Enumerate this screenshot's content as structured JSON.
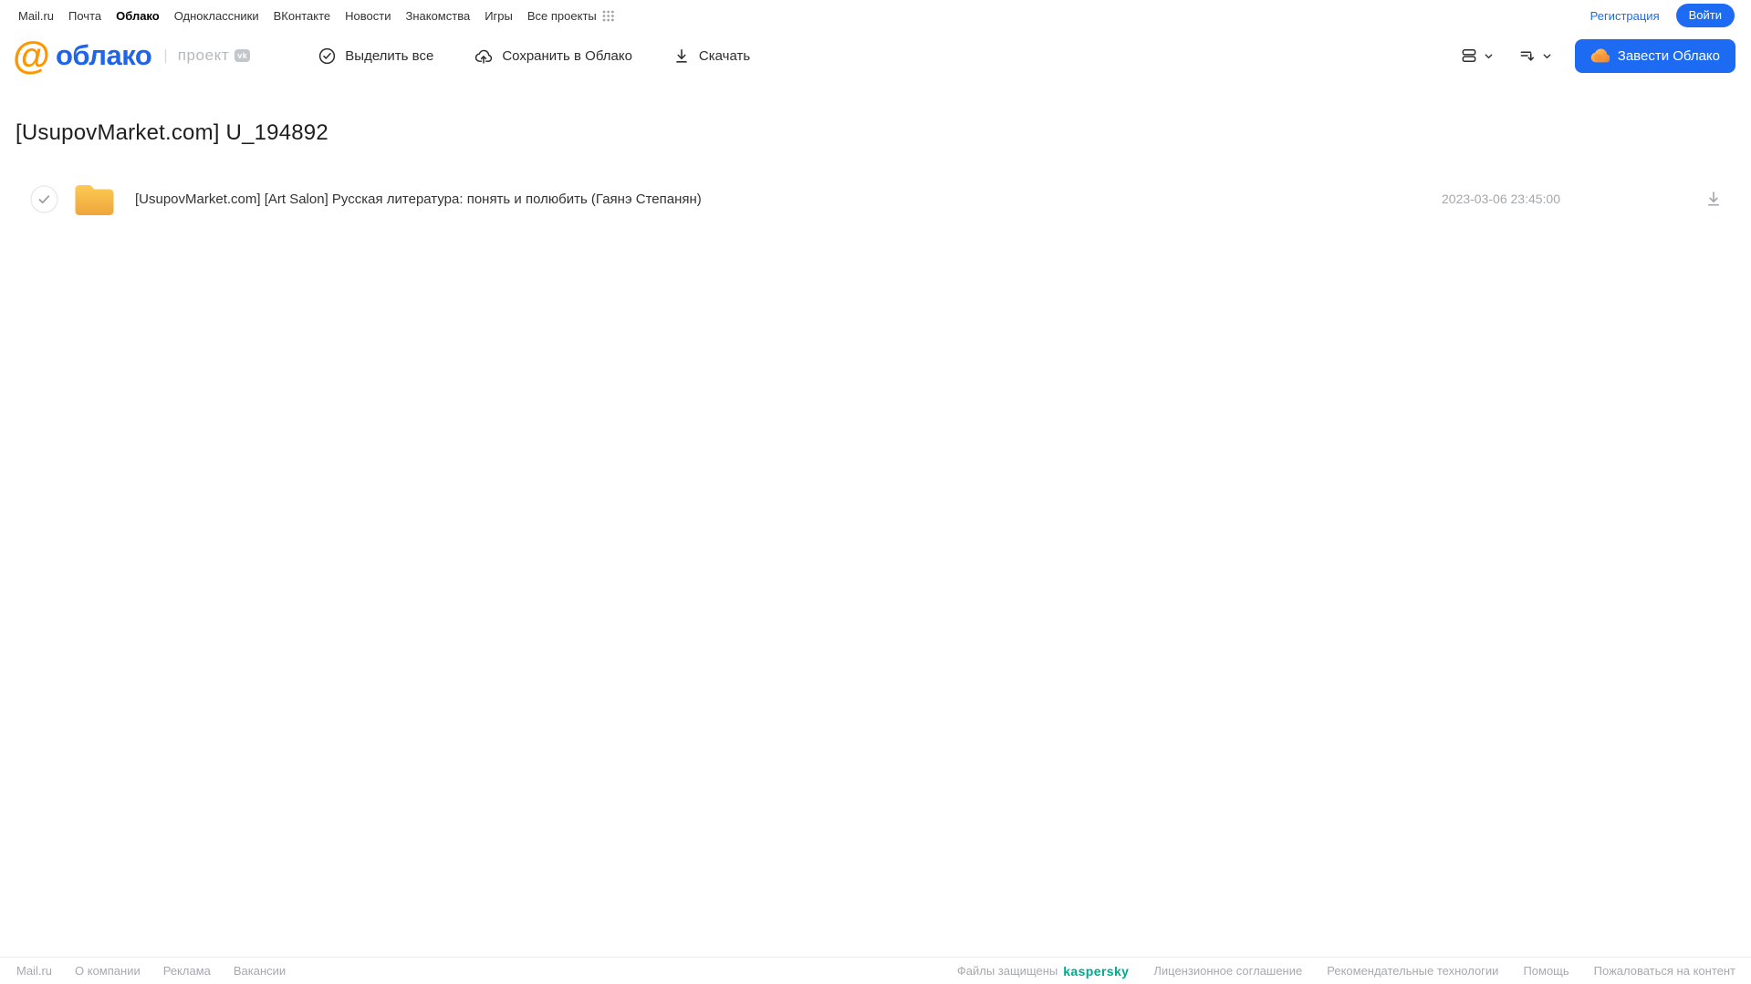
{
  "topnav": {
    "items": [
      {
        "label": "Mail.ru"
      },
      {
        "label": "Почта"
      },
      {
        "label": "Облако"
      },
      {
        "label": "Одноклассники"
      },
      {
        "label": "ВКонтакте"
      },
      {
        "label": "Новости"
      },
      {
        "label": "Знакомства"
      },
      {
        "label": "Игры"
      },
      {
        "label": "Все проекты"
      }
    ],
    "register_label": "Регистрация",
    "login_label": "Войти"
  },
  "header": {
    "logo": {
      "at": "@",
      "name": "облако",
      "divider": "|",
      "project": "проект",
      "vk_badge": "vk"
    },
    "toolbar": {
      "select_all": "Выделить все",
      "save_to_cloud": "Сохранить в Облако",
      "download": "Скачать"
    },
    "create_cloud": "Завести Облако"
  },
  "main": {
    "title": "[UsupovMarket.com] U_194892",
    "files": [
      {
        "name": "[UsupovMarket.com] [Art Salon] Русская литература: понять и полюбить (Гаянэ Степанян)",
        "date": "2023-03-06 23:45:00"
      }
    ]
  },
  "footer": {
    "left": [
      "Mail.ru",
      "О компании",
      "Реклама",
      "Вакансии"
    ],
    "protected_label": "Файлы защищены",
    "kaspersky": "kaspersky",
    "right": [
      "Лицензионное соглашение",
      "Рекомендательные технологии",
      "Помощь",
      "Пожаловаться на контент"
    ]
  },
  "colors": {
    "accent_blue": "#1d6bf3",
    "logo_orange": "#ff9500",
    "logo_blue": "#2064e8",
    "kaspersky_teal": "#00a88e",
    "folder_yellow": "#f6b545"
  }
}
